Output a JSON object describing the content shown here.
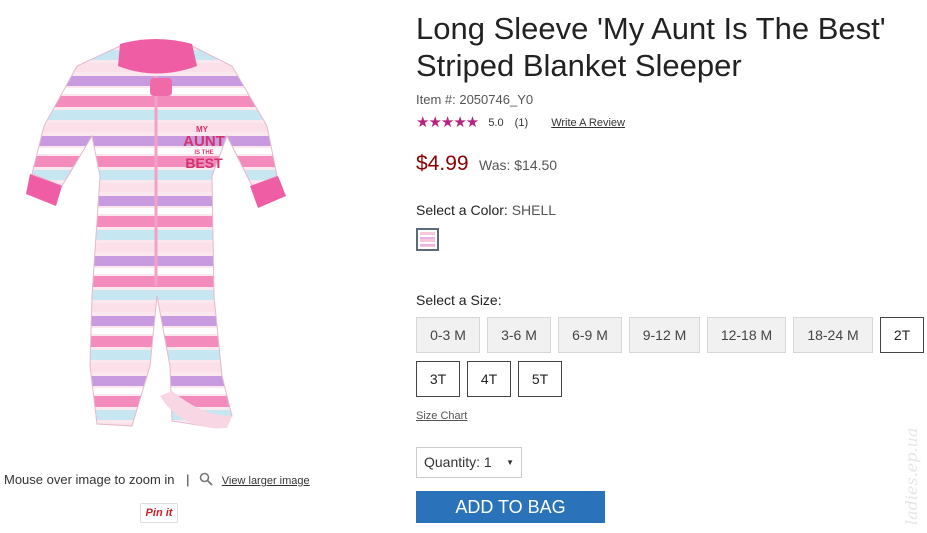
{
  "product": {
    "title_line1": "Long Sleeve 'My Aunt Is The Best'",
    "title_line2": "Striped Blanket Sleeper",
    "item_number": "Item #: 2050746_Y0",
    "rating": {
      "stars": "★★★★★",
      "score": "5.0",
      "count": "(1)",
      "review_link": "Write A Review"
    },
    "price": {
      "sale": "$4.99",
      "was": "Was: $14.50"
    },
    "color": {
      "label": "Select a Color:",
      "value": "SHELL"
    },
    "size": {
      "label": "Select a Size:",
      "options": [
        "0-3 M",
        "3-6 M",
        "6-9 M",
        "9-12 M",
        "12-18 M",
        "18-24 M",
        "2T",
        "3T",
        "4T",
        "5T"
      ],
      "chart_link": "Size Chart"
    },
    "quantity": {
      "label": "Quantity:",
      "value": "1"
    },
    "add_to_bag": "ADD TO BAG"
  },
  "image": {
    "graphic_text": [
      "MY",
      "AUNT",
      "IS THE",
      "BEST"
    ],
    "zoom_hint": "Mouse over image to zoom in",
    "separator": "|",
    "view_larger": "View larger image",
    "pin_label": "Pin it"
  },
  "watermark": "ladies.ep.ua",
  "colors": {
    "accent": "#2a72b9",
    "sale_price": "#8b0000",
    "stars": "#b4237e"
  },
  "icons": [
    "magnifier-icon",
    "star-icon",
    "caret-down-icon"
  ]
}
